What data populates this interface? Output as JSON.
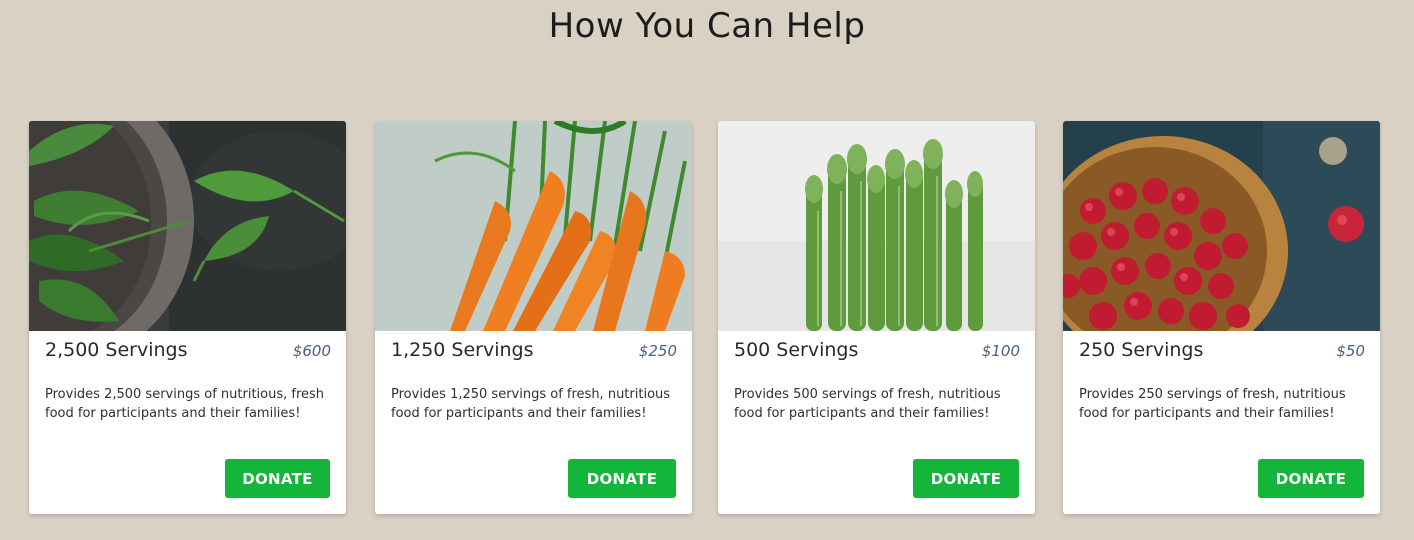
{
  "page": {
    "title": "How You Can Help",
    "background": "#d9d1c4",
    "accent": "#13b63a"
  },
  "cards": [
    {
      "image": "basil-leaves-in-stone-bowl",
      "servings": "2,500 Servings",
      "price": "$600",
      "description": "Provides 2,500 servings of nutritious, fresh food for participants and their families!",
      "button": "DONATE"
    },
    {
      "image": "fresh-carrots",
      "servings": "1,250 Servings",
      "price": "$250",
      "description": "Provides 1,250 servings of fresh, nutritious food for participants and their families!",
      "button": "DONATE"
    },
    {
      "image": "asparagus-bunch",
      "servings": "500 Servings",
      "price": "$100",
      "description": "Provides 500 servings of fresh, nutritious food for participants and their families!",
      "button": "DONATE"
    },
    {
      "image": "cranberries-in-wooden-bowl",
      "servings": "250 Servings",
      "price": "$50",
      "description": "Provides 250 servings of fresh, nutritious food for participants and their families!",
      "button": "DONATE"
    }
  ]
}
